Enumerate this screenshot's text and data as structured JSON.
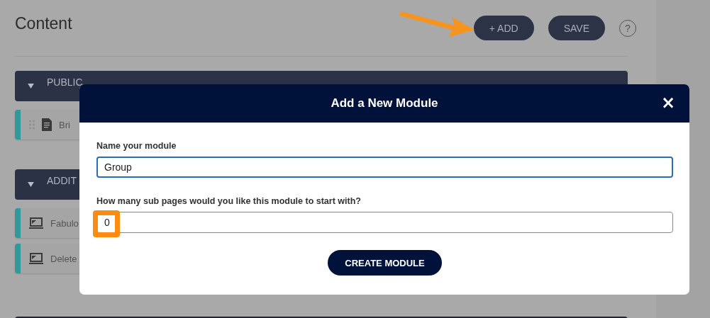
{
  "page": {
    "title": "Content",
    "buttons": [
      {
        "label": "+ ADD"
      },
      {
        "label": "SAVE"
      }
    ],
    "help": "?"
  },
  "sections": [
    {
      "title": "PUBLIC",
      "expanded": true,
      "items": [
        {
          "label": "Bri",
          "kind": "document"
        }
      ]
    },
    {
      "title": "ADDIT",
      "expanded": true,
      "items": [
        {
          "label": "Fabulo",
          "kind": "laptop"
        },
        {
          "label": "Delete",
          "kind": "laptop"
        }
      ]
    }
  ],
  "modal": {
    "title": "Add a New Module",
    "close": "×",
    "fields": [
      {
        "label": "Name your module",
        "value": "Group",
        "focused": true,
        "highlighted": false
      },
      {
        "label": "How many sub pages would you like this module to start with?",
        "value": "0",
        "focused": false,
        "highlighted": true
      }
    ],
    "submit": "CREATE MODULE"
  }
}
